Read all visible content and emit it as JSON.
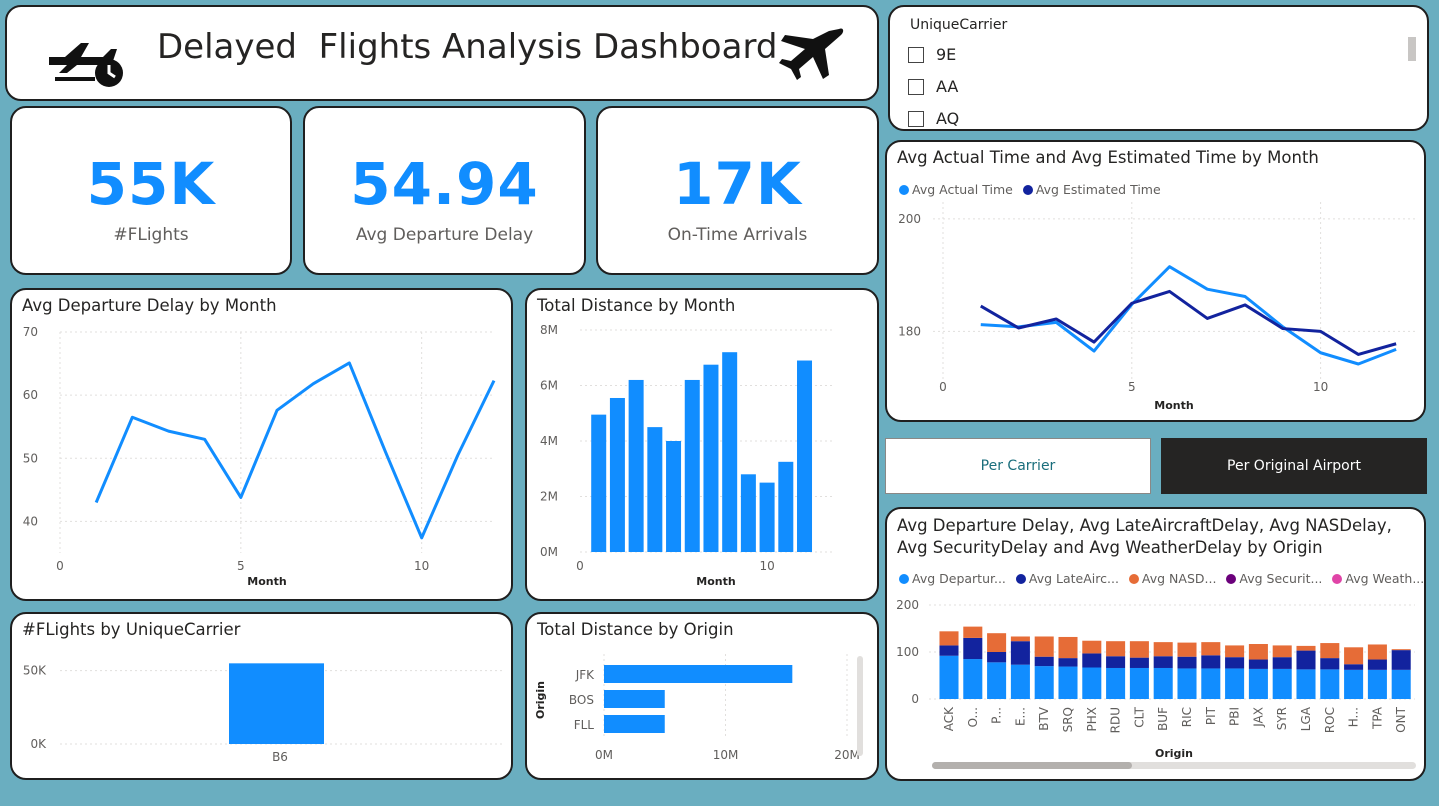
{
  "header": {
    "title": "Delayed  Flights Analysis Dashboard",
    "left_icon": "flight-delay-icon",
    "right_icon": "airplane-icon"
  },
  "kpis": [
    {
      "value": "55K",
      "label": "#FLights"
    },
    {
      "value": "54.94",
      "label": "Avg Departure Delay"
    },
    {
      "value": "17K",
      "label": "On-Time Arrivals"
    }
  ],
  "slicer": {
    "title": "UniqueCarrier",
    "items": [
      "9E",
      "AA",
      "AQ"
    ]
  },
  "buttons": {
    "per_carrier": "Per Carrier",
    "per_airport": "Per Original Airport"
  },
  "colors": {
    "accent": "#118dff",
    "dark_blue": "#12239e",
    "orange": "#e66c37",
    "purple": "#6b007b",
    "pink": "#e044a7",
    "active_button": "#252423"
  },
  "chart_data": [
    {
      "id": "delay_by_month",
      "type": "line",
      "title": "Avg Departure Delay by Month",
      "xlabel": "Month",
      "ylabel": "",
      "x": [
        1,
        2,
        3,
        4,
        5,
        6,
        7,
        8,
        9,
        10,
        11,
        12
      ],
      "values": [
        43,
        56.5,
        54.3,
        53,
        43.8,
        57.6,
        61.8,
        65.1,
        51,
        37.4,
        50.5,
        62.3
      ],
      "xlim": [
        0,
        12
      ],
      "ylim": [
        35,
        70
      ],
      "xticks": [
        "0",
        "5",
        "10"
      ],
      "yticks": [
        "40",
        "50",
        "60",
        "70"
      ],
      "grid": true
    },
    {
      "id": "distance_by_month",
      "type": "bar",
      "title": "Total Distance by Month",
      "xlabel": "Month",
      "ylabel": "",
      "x": [
        1,
        2,
        3,
        4,
        5,
        6,
        7,
        8,
        9,
        10,
        11,
        12
      ],
      "values": [
        4.95,
        5.55,
        6.2,
        4.5,
        4.0,
        6.2,
        6.75,
        7.2,
        2.8,
        2.5,
        3.25,
        6.9
      ],
      "unit": "M",
      "ylim": [
        0,
        8
      ],
      "xticks": [
        "0",
        "10"
      ],
      "yticks": [
        "0M",
        "2M",
        "4M",
        "6M",
        "8M"
      ],
      "grid": true
    },
    {
      "id": "time_by_month",
      "type": "line",
      "title": "Avg Actual Time and Avg Estimated Time by Month",
      "xlabel": "Month",
      "ylabel": "",
      "x": [
        1,
        2,
        3,
        4,
        5,
        6,
        7,
        8,
        9,
        10,
        11,
        12
      ],
      "series": [
        {
          "name": "Avg Actual Time",
          "color": "#118dff",
          "values": [
            181.2,
            180.8,
            181.6,
            176.5,
            184.8,
            191.5,
            187.5,
            186.2,
            180.8,
            176.2,
            174.2,
            176.8
          ]
        },
        {
          "name": "Avg Estimated Time",
          "color": "#12239e",
          "values": [
            184.5,
            180.6,
            182.2,
            178.1,
            185.0,
            187.1,
            182.3,
            184.7,
            180.5,
            180.0,
            175.9,
            177.8
          ]
        }
      ],
      "xlim": [
        0,
        12.5
      ],
      "ylim": [
        171,
        203
      ],
      "xticks": [
        "0",
        "5",
        "10"
      ],
      "yticks": [
        "180",
        "200"
      ],
      "legend": "top-left",
      "grid": true
    },
    {
      "id": "flights_by_carrier",
      "type": "bar",
      "title": "#FLights by UniqueCarrier",
      "categories": [
        "B6"
      ],
      "values": [
        55
      ],
      "unit": "K",
      "ylim": [
        0,
        60
      ],
      "yticks": [
        "0K",
        "50K"
      ],
      "grid": true
    },
    {
      "id": "distance_by_origin",
      "type": "bar",
      "orientation": "horizontal",
      "title": "Total Distance by Origin",
      "ylabel": "Origin",
      "categories": [
        "JFK",
        "BOS",
        "FLL"
      ],
      "values": [
        15.5,
        5.0,
        5.0
      ],
      "unit": "M",
      "xlim": [
        0,
        20
      ],
      "xticks": [
        "0M",
        "10M",
        "20M"
      ],
      "grid": true
    },
    {
      "id": "delays_by_origin",
      "type": "bar",
      "stacked": true,
      "title": "Avg Departure Delay, Avg LateAircraftDelay, Avg NASDelay, Avg SecurityDelay and Avg WeatherDelay by Origin",
      "xlabel": "Origin",
      "categories": [
        "ACK",
        "O...",
        "P...",
        "E...",
        "BTV",
        "SRQ",
        "PHX",
        "RDU",
        "CLT",
        "BUF",
        "RIC",
        "PIT",
        "PBI",
        "JAX",
        "SYR",
        "LGA",
        "ROC",
        "H...",
        "TPA",
        "ONT"
      ],
      "ylim": [
        0,
        200
      ],
      "yticks": [
        "0",
        "100",
        "200"
      ],
      "legend": "top",
      "grid": true,
      "series": [
        {
          "name": "Avg Departur...",
          "color": "#118dff",
          "values": [
            92,
            85,
            78,
            73,
            70,
            69,
            67,
            66,
            66,
            66,
            65,
            65,
            65,
            64,
            64,
            63,
            63,
            62,
            62,
            62
          ]
        },
        {
          "name": "Avg LateAirc...",
          "color": "#12239e",
          "values": [
            22,
            45,
            22,
            50,
            20,
            18,
            30,
            25,
            22,
            25,
            25,
            28,
            24,
            20,
            25,
            40,
            24,
            12,
            22,
            42
          ]
        },
        {
          "name": "Avg NASD...",
          "color": "#e66c37",
          "values": [
            30,
            24,
            40,
            10,
            43,
            45,
            27,
            32,
            35,
            30,
            30,
            28,
            25,
            33,
            25,
            10,
            32,
            36,
            32,
            2
          ]
        },
        {
          "name": "Avg Securit...",
          "color": "#6b007b",
          "values": [
            0,
            0,
            0,
            0,
            0,
            0,
            0,
            0,
            0,
            0,
            0,
            0,
            0,
            0,
            0,
            0,
            0,
            0,
            0,
            0
          ]
        },
        {
          "name": "Avg Weath...",
          "color": "#e044a7",
          "values": [
            0,
            0,
            0,
            0,
            0,
            0,
            0,
            0,
            0,
            0,
            0,
            0,
            0,
            0,
            0,
            0,
            0,
            0,
            0,
            0
          ]
        }
      ]
    }
  ]
}
